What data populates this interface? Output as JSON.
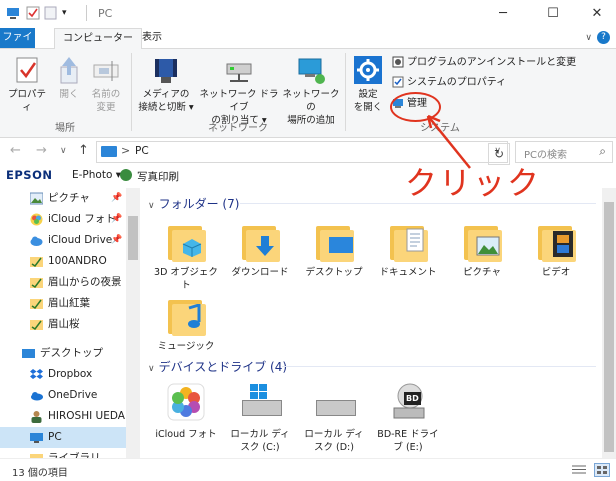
{
  "window": {
    "title": "PC",
    "controls": [
      "─",
      "☐",
      "✕"
    ]
  },
  "ribbon_tabs": {
    "file": "ファイル",
    "computer": "コンピューター",
    "view": "表示",
    "help": "?"
  },
  "ribbon": {
    "location_group": {
      "label": "場所",
      "properties": "プロパティ",
      "open": "開く",
      "rename_line1": "名前の",
      "rename_line2": "変更"
    },
    "network_group": {
      "label": "ネットワーク",
      "media_line1": "メディアの",
      "media_line2": "接続と切断 ▾",
      "map_drive_line1": "ネットワーク ドライブ",
      "map_drive_line2": "の割り当て ▾",
      "add_location_line1": "ネットワークの",
      "add_location_line2": "場所の追加"
    },
    "system_group": {
      "label": "システム",
      "settings_line1": "設定",
      "settings_line2": "を開く",
      "uninstall": "プログラムのアンインストールと変更",
      "system_properties": "システムのプロパティ",
      "manage": "管理"
    }
  },
  "address_bar": {
    "back": "←",
    "forward": "→",
    "recent": "∨",
    "up": "↑",
    "separator": ">",
    "path": "PC",
    "dropdown": "∨",
    "refresh": "↻",
    "search_placeholder": "PCの検索",
    "search_icon": "⌕"
  },
  "epson_bar": {
    "logo": "EPSON",
    "app": "E-Photo ▾",
    "print": "写真印刷"
  },
  "nav_pane": {
    "items": [
      {
        "label": "ピクチャ",
        "pinned": true
      },
      {
        "label": "iCloud フォト",
        "pinned": true
      },
      {
        "label": "iCloud Drive",
        "pinned": true
      },
      {
        "label": "100ANDRO",
        "pinned": false
      },
      {
        "label": "眉山からの夜景",
        "pinned": false
      },
      {
        "label": "眉山紅葉",
        "pinned": false
      },
      {
        "label": "眉山桜",
        "pinned": false
      },
      {
        "label": "デスクトップ",
        "pinned": false
      },
      {
        "label": "Dropbox",
        "pinned": false
      },
      {
        "label": "OneDrive",
        "pinned": false
      },
      {
        "label": "HIROSHI UEDA",
        "pinned": false
      },
      {
        "label": "PC",
        "pinned": false,
        "selected": true
      },
      {
        "label": "ライブラリ",
        "pinned": false
      }
    ],
    "pin_glyph": "📌"
  },
  "content": {
    "folders_header": "フォルダー (7)",
    "folders": [
      {
        "label": "3D オブジェク",
        "label2": "ト"
      },
      {
        "label": "ダウンロード",
        "label2": ""
      },
      {
        "label": "デスクトップ",
        "label2": ""
      },
      {
        "label": "ドキュメント",
        "label2": ""
      },
      {
        "label": "ピクチャ",
        "label2": ""
      },
      {
        "label": "ビデオ",
        "label2": ""
      },
      {
        "label": "ミュージック",
        "label2": ""
      }
    ],
    "devices_header": "デバイスとドライブ (4)",
    "devices": [
      {
        "label": "iCloud フォト",
        "label2": ""
      },
      {
        "label": "ローカル ディ",
        "label2": "スク (C:)"
      },
      {
        "label": "ローカル ディ",
        "label2": "スク (D:)"
      },
      {
        "label": "BD-RE ドライ",
        "label2": "ブ (E:)"
      }
    ],
    "bd_badge": "BD",
    "chevron": "∨"
  },
  "annotation": {
    "text": "クリック"
  },
  "status_bar": {
    "count": "13 個の項目"
  },
  "colors": {
    "accent": "#1979ca",
    "annotation": "#e0341f",
    "selected_bg": "#cce4f7",
    "header_text": "#1e3287",
    "folder": "#fbd57a"
  }
}
